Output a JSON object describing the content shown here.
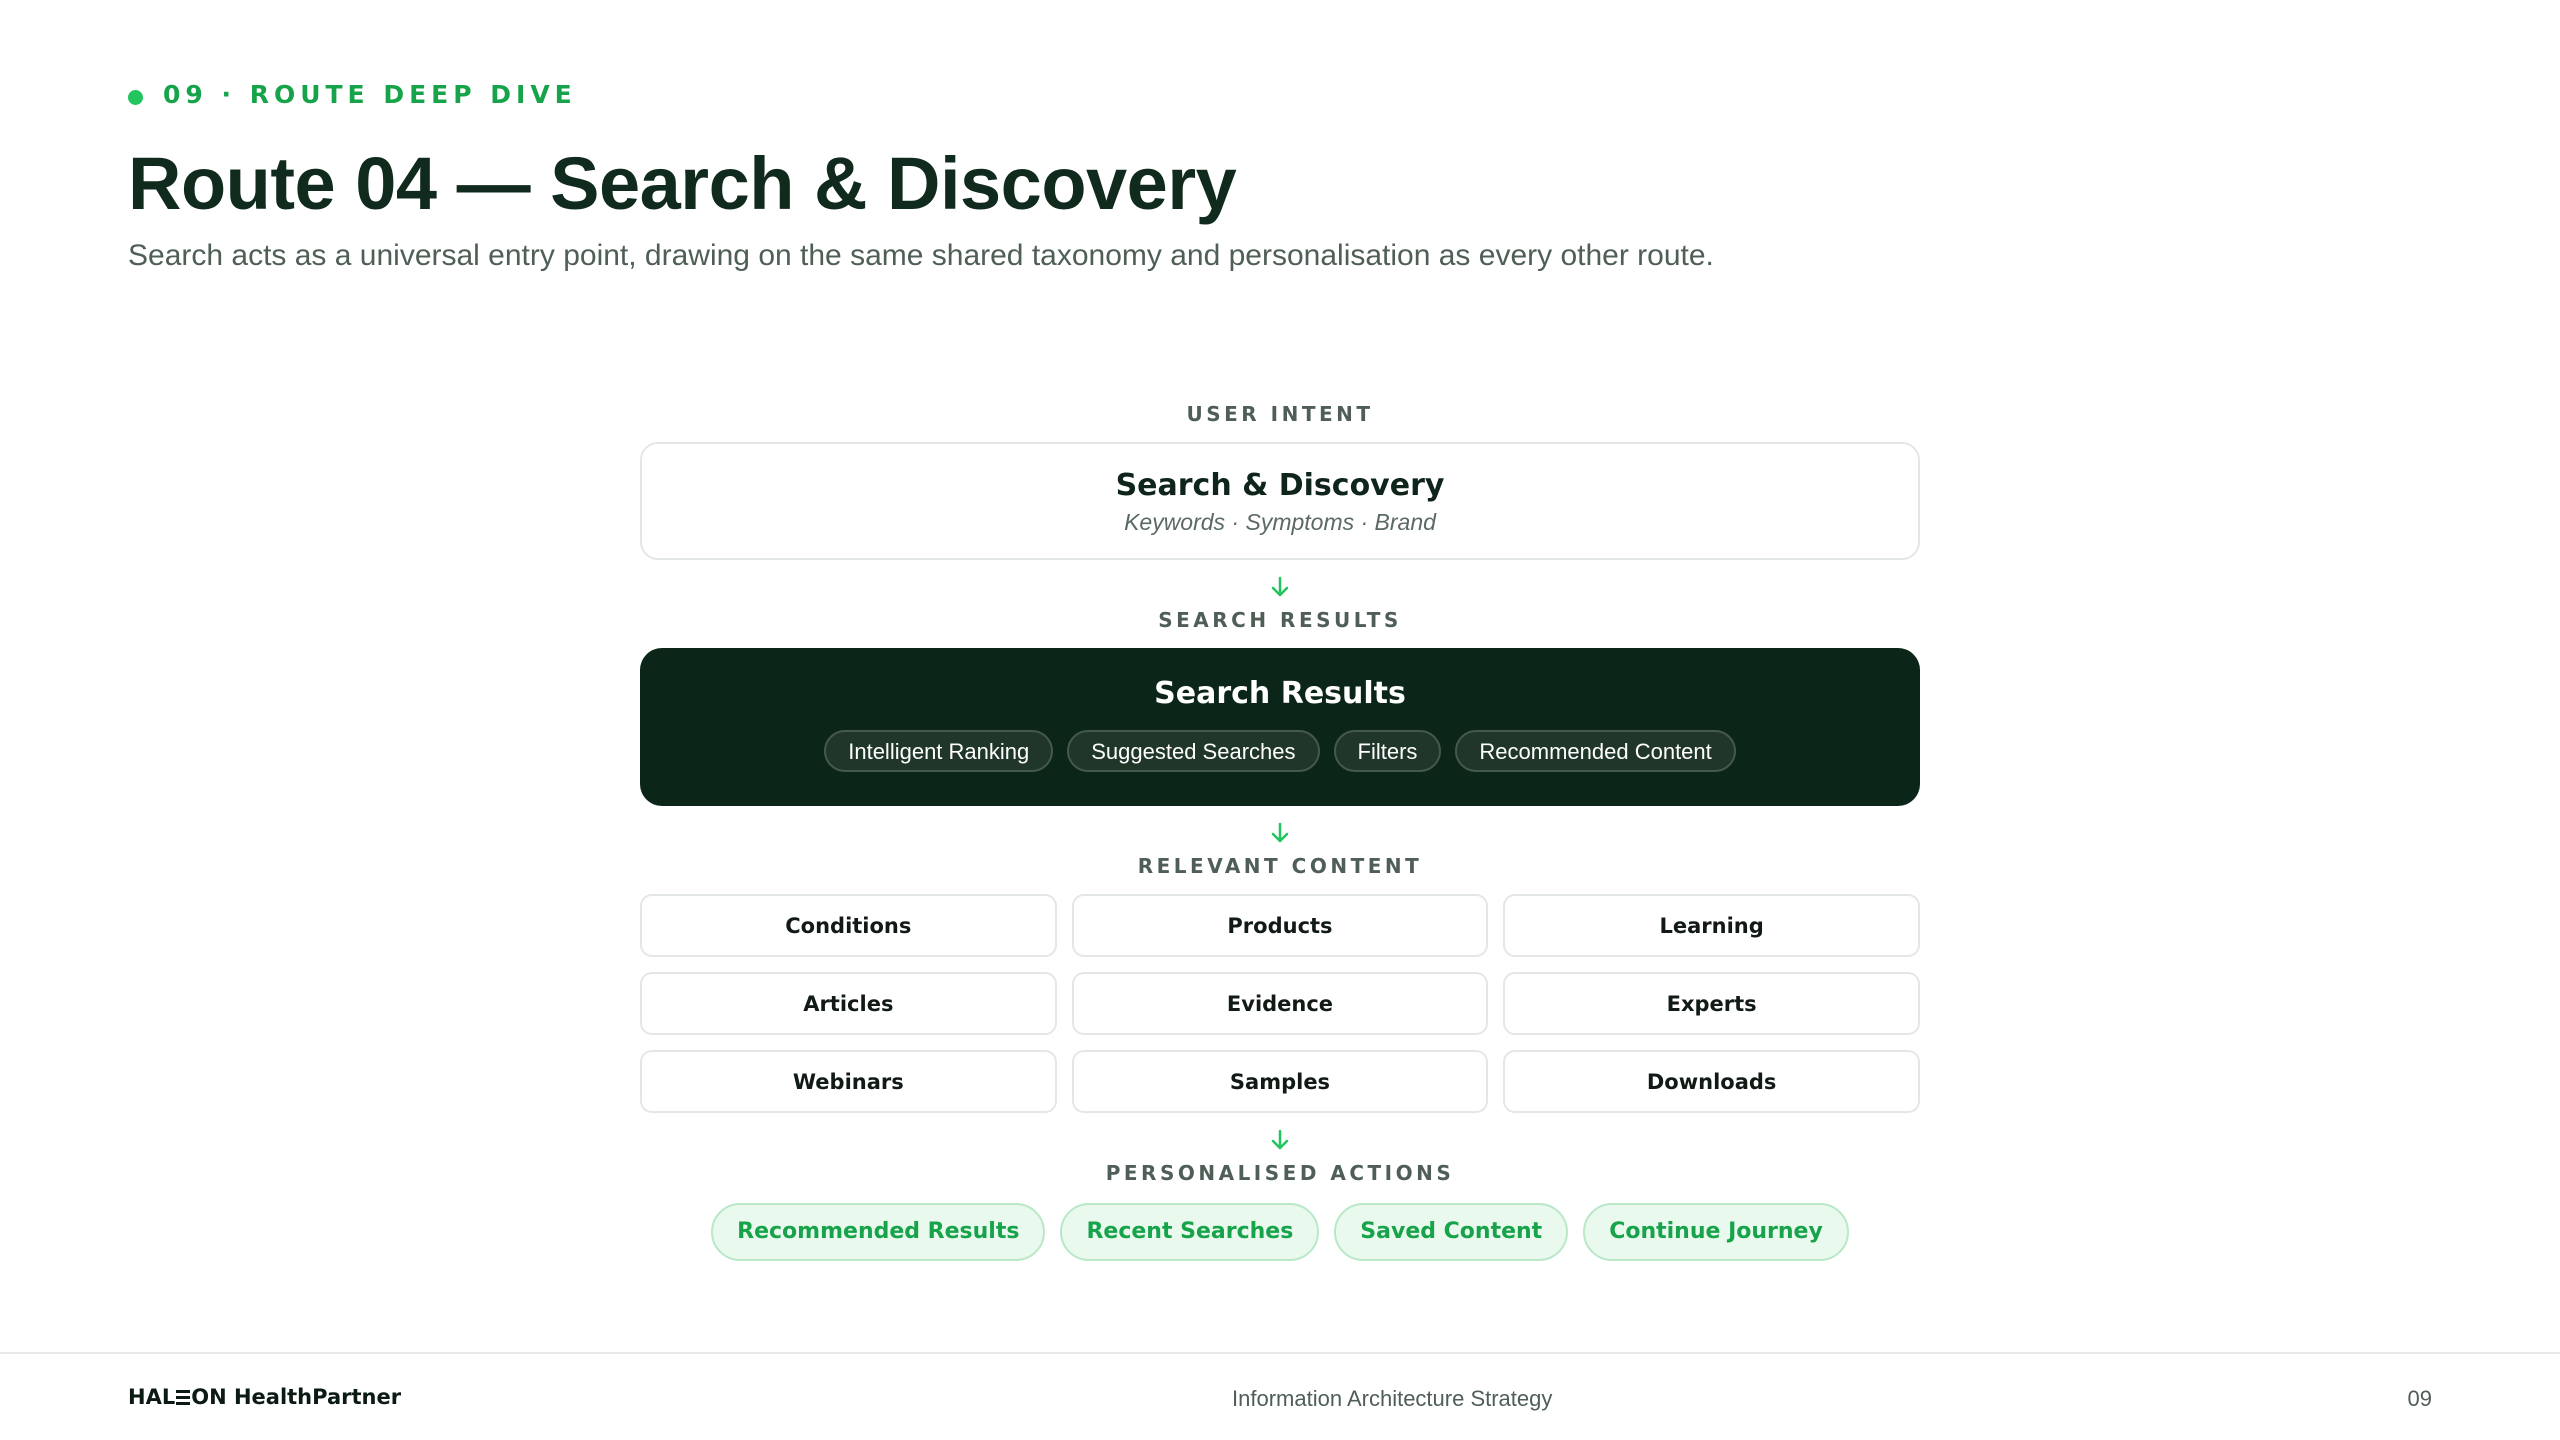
{
  "header": {
    "eyebrow": "09 · ROUTE DEEP DIVE",
    "title": "Route 04 — Search & Discovery",
    "subtitle": "Search acts as a universal entry point, drawing on the same shared taxonomy and personalisation as every other route."
  },
  "flow": {
    "intent": {
      "label": "USER INTENT",
      "title": "Search & Discovery",
      "subtitle": "Keywords · Symptoms · Brand"
    },
    "results": {
      "label": "SEARCH RESULTS",
      "title": "Search Results",
      "chips": [
        "Intelligent Ranking",
        "Suggested Searches",
        "Filters",
        "Recommended Content"
      ]
    },
    "content": {
      "label": "RELEVANT CONTENT",
      "items": [
        "Conditions",
        "Products",
        "Learning",
        "Articles",
        "Evidence",
        "Experts",
        "Webinars",
        "Samples",
        "Downloads"
      ]
    },
    "actions": {
      "label": "PERSONALISED ACTIONS",
      "items": [
        "Recommended Results",
        "Recent Searches",
        "Saved Content",
        "Continue Journey"
      ]
    },
    "arrow_icon": "arrow-down-icon"
  },
  "footer": {
    "logo_left": "HAL",
    "logo_right": "ON HealthPartner",
    "center": "Information Architecture Strategy",
    "page": "09"
  },
  "colors": {
    "accent": "#22c55e",
    "accent_text": "#16a34a",
    "dark": "#0b2619",
    "pill_bg": "#e9f9ee",
    "pill_border": "#b9e8c7"
  }
}
